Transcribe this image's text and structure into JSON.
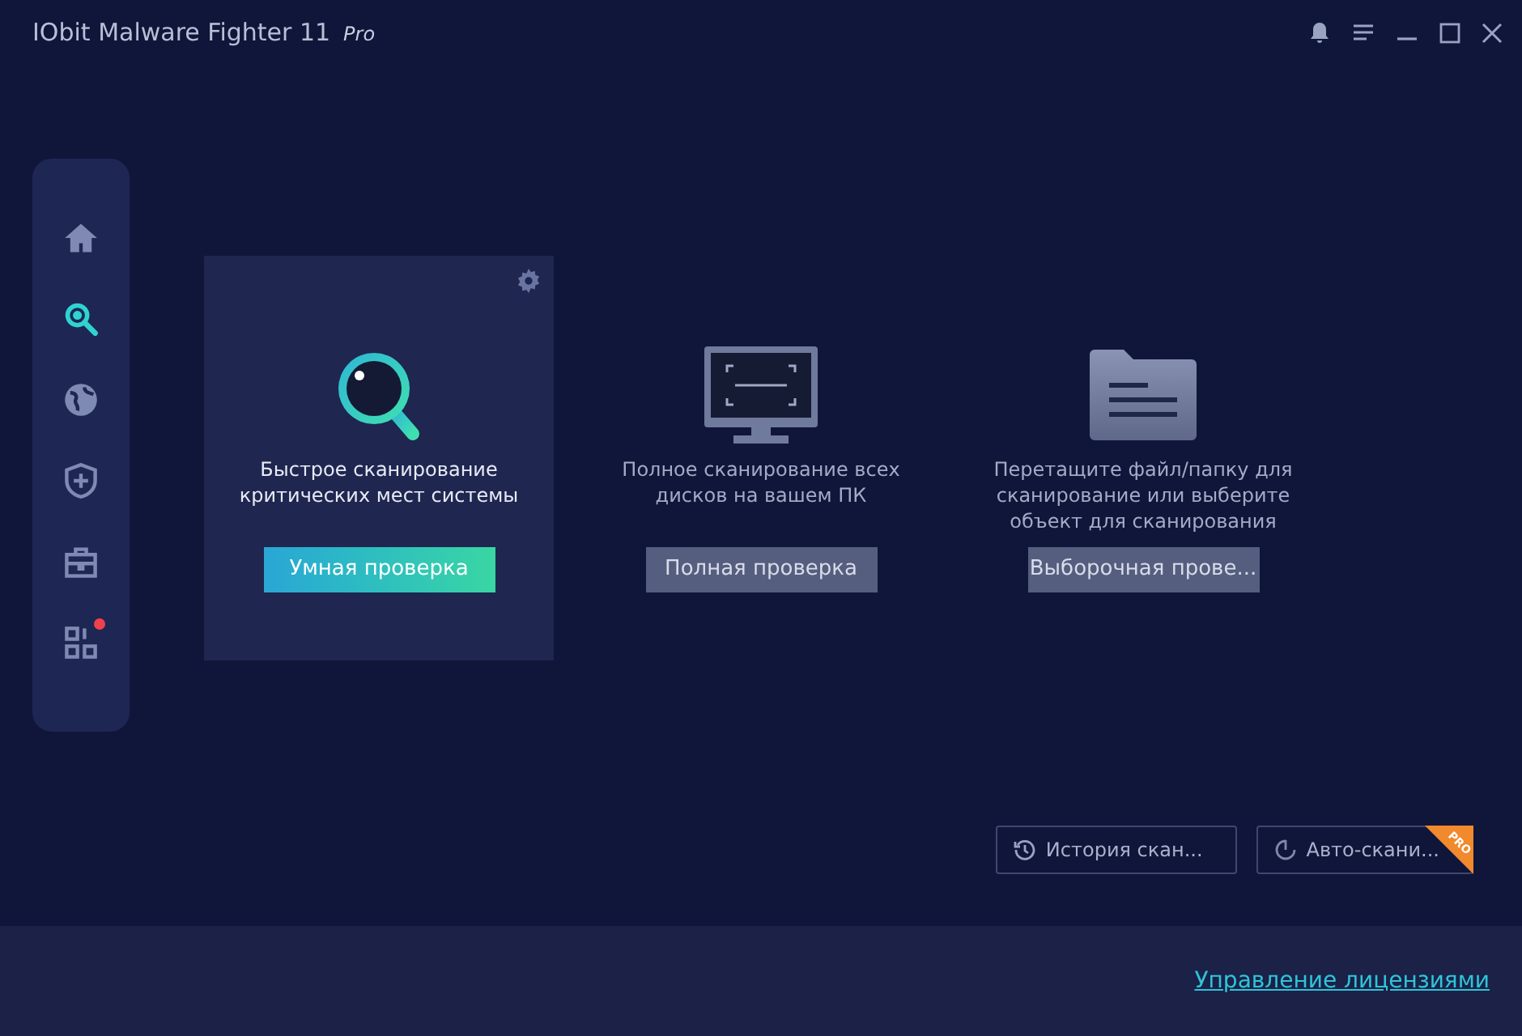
{
  "window": {
    "title": "IObit Malware Fighter 11",
    "edition": "Pro"
  },
  "sidebar": {
    "items": [
      {
        "kind": "home",
        "selected": false,
        "badge": false
      },
      {
        "kind": "scan",
        "selected": true,
        "badge": false
      },
      {
        "kind": "globe",
        "selected": false,
        "badge": false
      },
      {
        "kind": "shield",
        "selected": false,
        "badge": false
      },
      {
        "kind": "toolbox",
        "selected": false,
        "badge": false
      },
      {
        "kind": "apps",
        "selected": false,
        "badge": true
      }
    ]
  },
  "scans": [
    {
      "kind": "search",
      "selected": true,
      "description": "Быстрое сканирование критических мест системы",
      "button": "Умная проверка"
    },
    {
      "kind": "monitor",
      "selected": false,
      "description": "Полное сканирование всех дисков на вашем ПК",
      "button": "Полная проверка"
    },
    {
      "kind": "folder",
      "selected": false,
      "description": "Перетащите файл/папку для сканирование или выберите объект для сканирования",
      "button": "Выборочная прове..."
    }
  ],
  "actions": [
    {
      "kind": "history",
      "label": "История скан..."
    },
    {
      "kind": "auto",
      "label": "Авто-скани...",
      "badge": "PRO"
    }
  ],
  "footer": {
    "link": "Управление лицензиями"
  }
}
